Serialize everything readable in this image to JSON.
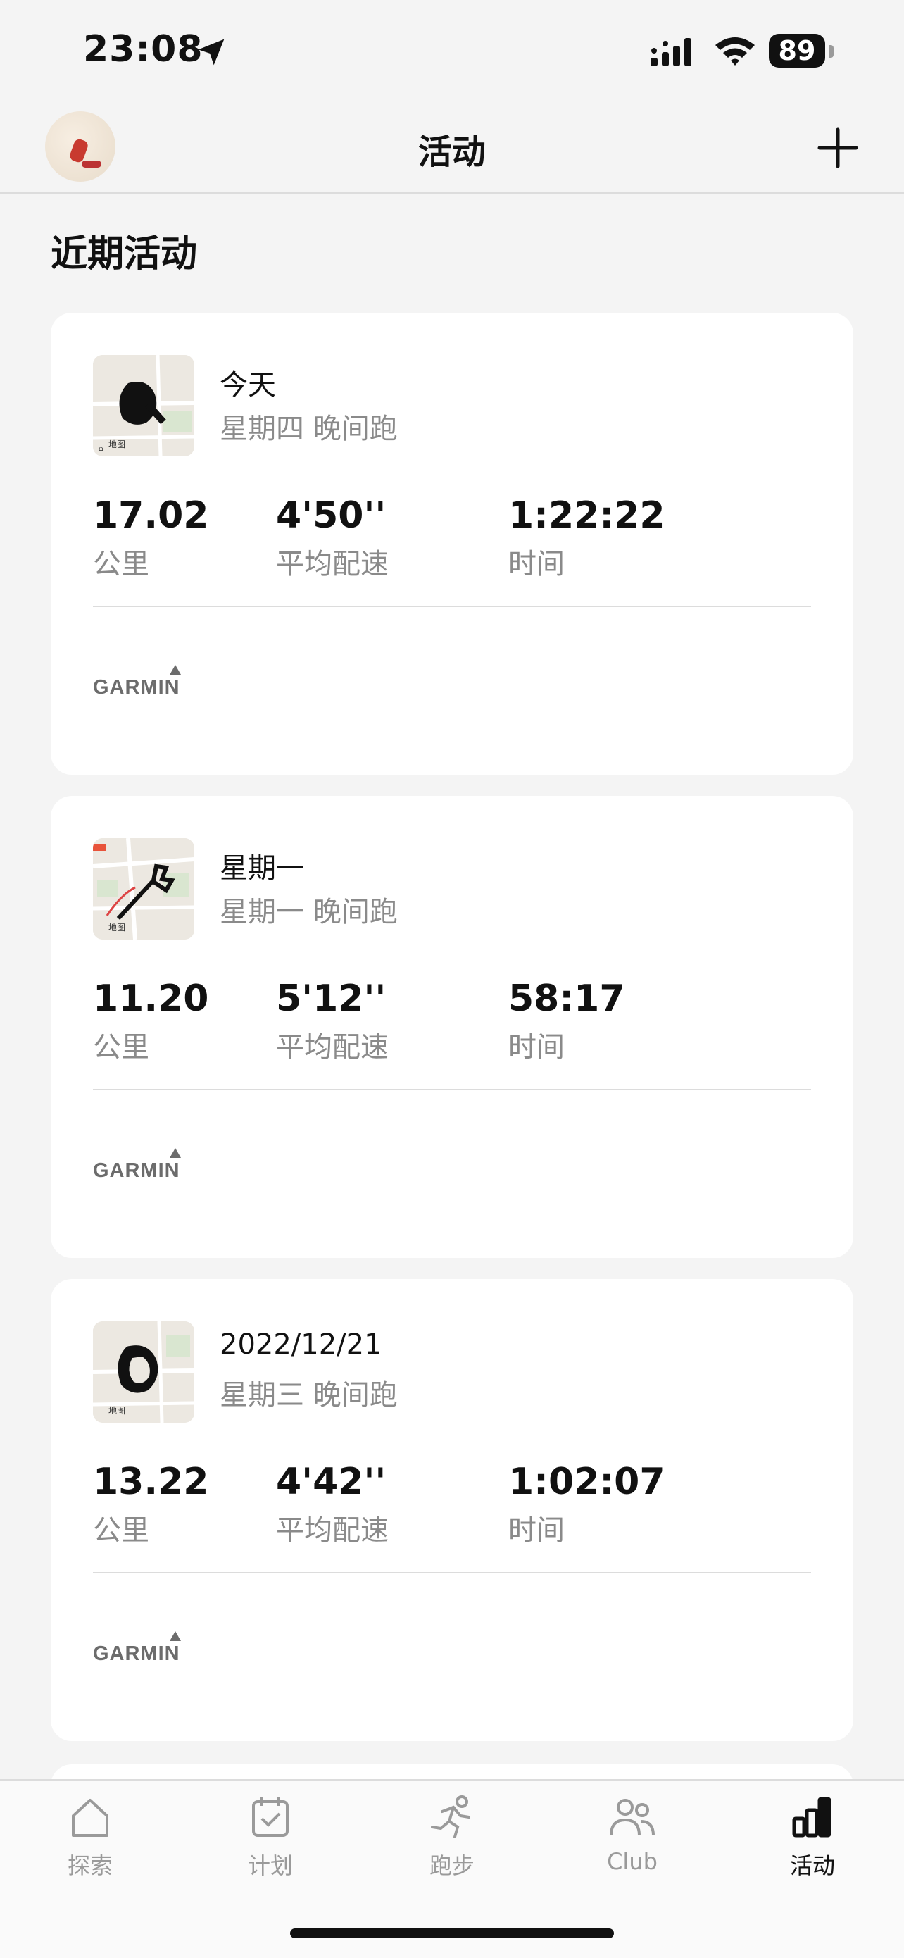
{
  "status_bar": {
    "time": "23:08",
    "battery": "89"
  },
  "nav": {
    "title": "活动"
  },
  "section_title": "近期活动",
  "activities": [
    {
      "date": "今天",
      "subtitle": "星期四 晚间跑",
      "stats": [
        {
          "value": "17.02",
          "label": "公里"
        },
        {
          "value": "4'50''",
          "label": "平均配速"
        },
        {
          "value": "1:22:22",
          "label": "时间"
        }
      ],
      "brand": "GARMIN",
      "map_label": "地图"
    },
    {
      "date": "星期一",
      "subtitle": "星期一 晚间跑",
      "stats": [
        {
          "value": "11.20",
          "label": "公里"
        },
        {
          "value": "5'12''",
          "label": "平均配速"
        },
        {
          "value": "58:17",
          "label": "时间"
        }
      ],
      "brand": "GARMIN",
      "map_label": "地图"
    },
    {
      "date": "2022/12/21",
      "subtitle": "星期三 晚间跑",
      "stats": [
        {
          "value": "13.22",
          "label": "公里"
        },
        {
          "value": "4'42''",
          "label": "平均配速"
        },
        {
          "value": "1:02:07",
          "label": "时间"
        }
      ],
      "brand": "GARMIN",
      "map_label": "地图"
    }
  ],
  "tabs": [
    {
      "label": "探索",
      "icon": "home-icon",
      "active": false
    },
    {
      "label": "计划",
      "icon": "calendar-check-icon",
      "active": false
    },
    {
      "label": "跑步",
      "icon": "runner-icon",
      "active": false
    },
    {
      "label": "Club",
      "icon": "people-icon",
      "active": false
    },
    {
      "label": "活动",
      "icon": "bar-chart-icon",
      "active": true
    }
  ]
}
